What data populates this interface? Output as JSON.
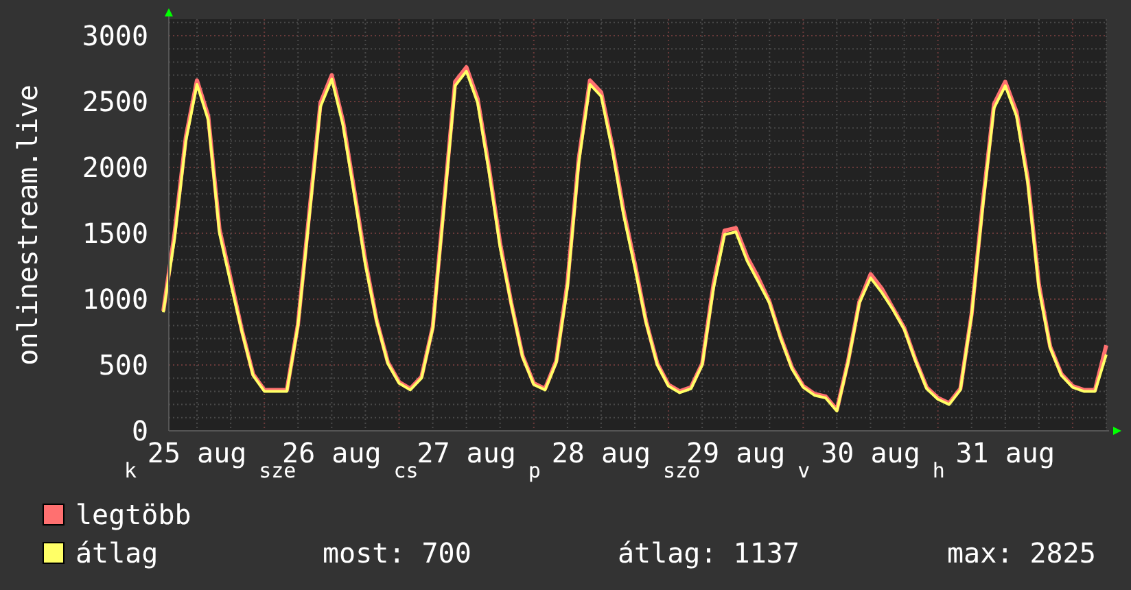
{
  "graph": {
    "chart_data": {
      "type": "line",
      "ylabel": "onlinestream.live",
      "ylim": [
        0,
        3000
      ],
      "grid": true,
      "yticks": [
        0,
        500,
        1000,
        1500,
        2000,
        2500,
        3000
      ],
      "categories": [
        null,
        null,
        null,
        "25 aug",
        null,
        null,
        null,
        null,
        null,
        null,
        null,
        null,
        null,
        null,
        null,
        "26 aug",
        null,
        null,
        null,
        null,
        null,
        null,
        null,
        null,
        null,
        null,
        null,
        "27 aug",
        null,
        null,
        null,
        null,
        null,
        null,
        null,
        null,
        null,
        null,
        null,
        "28 aug",
        null,
        null,
        null,
        null,
        null,
        null,
        null,
        null,
        null,
        null,
        null,
        "29 aug",
        null,
        null,
        null,
        null,
        null,
        null,
        null,
        null,
        null,
        null,
        null,
        "30 aug",
        null,
        null,
        null,
        null,
        null,
        null,
        null,
        null,
        null,
        null,
        null,
        "31 aug",
        null,
        null,
        null,
        null,
        null,
        null,
        null,
        null,
        null
      ],
      "series": [
        {
          "name": "legtöbb",
          "color": "#ff7070",
          "values": [
            910,
            1500,
            2230,
            2660,
            2390,
            1530,
            1150,
            760,
            430,
            310,
            310,
            310,
            810,
            1650,
            2490,
            2700,
            2350,
            1830,
            1290,
            840,
            520,
            370,
            320,
            410,
            790,
            1730,
            2650,
            2760,
            2520,
            2000,
            1420,
            970,
            570,
            360,
            320,
            530,
            1120,
            2060,
            2660,
            2570,
            2160,
            1670,
            1270,
            830,
            510,
            350,
            300,
            330,
            510,
            1110,
            1520,
            1540,
            1320,
            1160,
            980,
            710,
            480,
            340,
            280,
            260,
            160,
            530,
            980,
            1190,
            1080,
            930,
            780,
            540,
            330,
            250,
            210,
            320,
            890,
            1730,
            2480,
            2650,
            2420,
            1910,
            1110,
            640,
            430,
            340,
            310,
            310,
            650
          ]
        },
        {
          "name": "átlag",
          "color": "#ffff66",
          "values": [
            900,
            1460,
            2200,
            2630,
            2360,
            1500,
            1120,
            750,
            420,
            300,
            300,
            300,
            800,
            1620,
            2460,
            2670,
            2320,
            1800,
            1260,
            830,
            510,
            360,
            310,
            400,
            780,
            1700,
            2620,
            2730,
            2490,
            1970,
            1390,
            960,
            560,
            350,
            310,
            520,
            1090,
            2030,
            2630,
            2540,
            2130,
            1640,
            1240,
            820,
            500,
            340,
            290,
            320,
            500,
            1080,
            1490,
            1510,
            1290,
            1130,
            970,
            700,
            470,
            330,
            270,
            250,
            150,
            520,
            970,
            1160,
            1050,
            920,
            770,
            530,
            320,
            240,
            200,
            310,
            880,
            1700,
            2450,
            2620,
            2390,
            1880,
            1080,
            630,
            420,
            330,
            300,
            300,
            580
          ]
        }
      ]
    },
    "weekday_labels": [
      "k",
      "sze",
      "cs",
      "p",
      "szo",
      "v",
      "h"
    ],
    "stats": [
      "most: 700",
      "átlag: 1137",
      "max: 2825"
    ]
  }
}
